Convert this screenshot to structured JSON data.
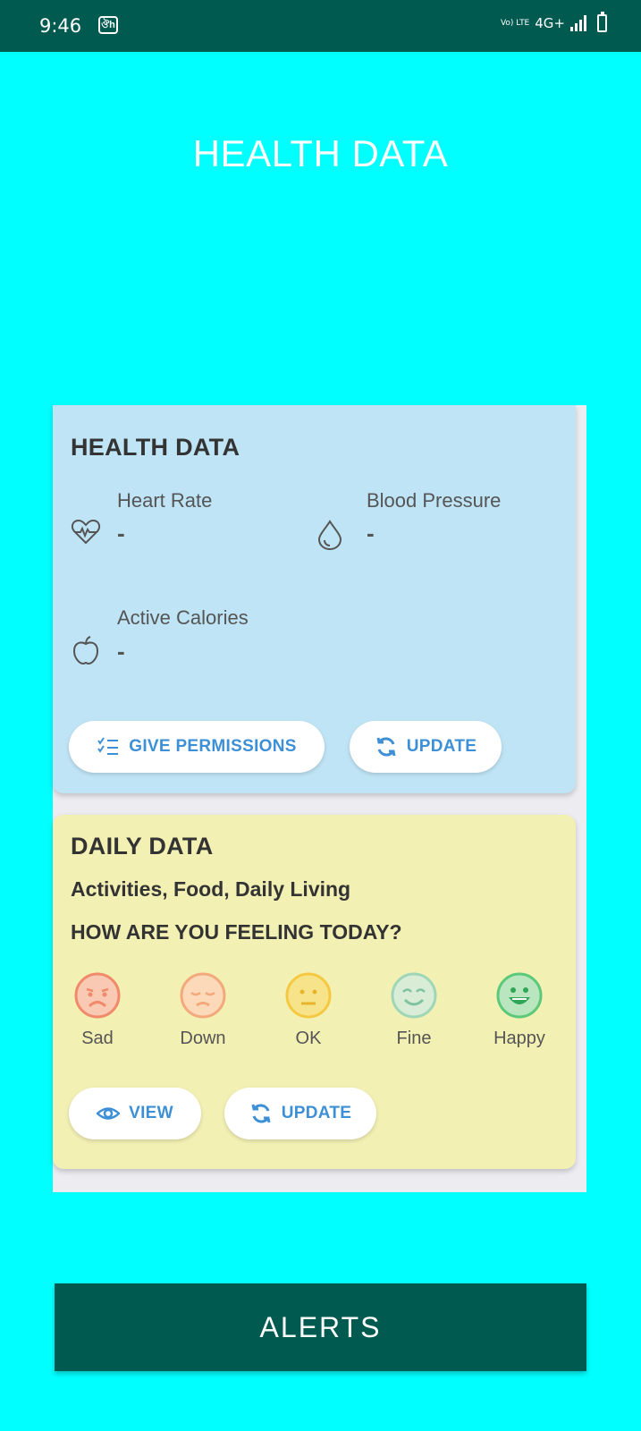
{
  "status_bar": {
    "time": "9:46",
    "app_badge": "ঔh",
    "volte": "Vo) LTE",
    "network": "4G+"
  },
  "page_title": "HEALTH DATA",
  "health_card": {
    "title": "HEALTH DATA",
    "heart_rate": {
      "label": "Heart Rate",
      "value": "-"
    },
    "blood_pressure": {
      "label": "Blood Pressure",
      "value": "-"
    },
    "active_calories": {
      "label": "Active Calories",
      "value": "-"
    },
    "give_permissions_label": "GIVE PERMISSIONS",
    "update_label": "UPDATE"
  },
  "daily_card": {
    "title": "DAILY DATA",
    "subtitle": "Activities, Food, Daily Living",
    "question": "HOW ARE YOU FEELING TODAY?",
    "moods": [
      {
        "label": "Sad",
        "color": "#f08a6a"
      },
      {
        "label": "Down",
        "color": "#f3a97b"
      },
      {
        "label": "OK",
        "color": "#f5c842"
      },
      {
        "label": "Fine",
        "color": "#9fd6b8"
      },
      {
        "label": "Happy",
        "color": "#5cc97a"
      }
    ],
    "view_label": "VIEW",
    "update_label": "UPDATE"
  },
  "alerts_label": "ALERTS",
  "colors": {
    "background": "#00ffff",
    "dark_teal": "#005a50",
    "health_card": "#bfe4f5",
    "daily_card": "#f3f0b4",
    "button_text": "#3d8fd6"
  }
}
